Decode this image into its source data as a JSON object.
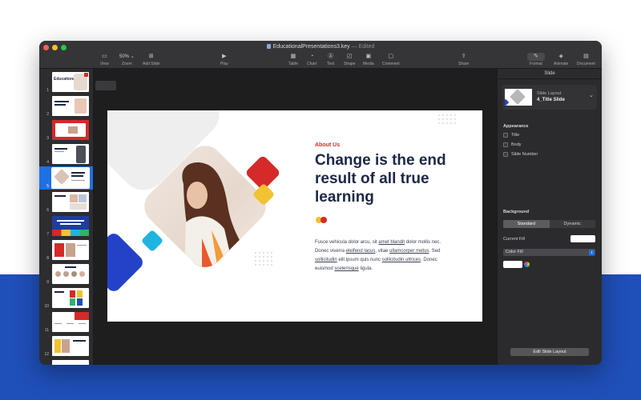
{
  "window": {
    "title": "EducationalPresentations3.key",
    "status": "— Edited"
  },
  "toolbar": {
    "view": "View",
    "zoom_value": "50% ⌄",
    "zoom": "Zoom",
    "add_slide": "Add Slide",
    "play": "Play",
    "table": "Table",
    "chart": "Chart",
    "text": "Text",
    "shape": "Shape",
    "media": "Media",
    "comment": "Comment",
    "share": "Share",
    "format": "Format",
    "animate": "Animate",
    "document": "Document"
  },
  "navigator": {
    "selected": 5,
    "thumbs": [
      {
        "num": "1",
        "title": "Educational"
      },
      {
        "num": "2",
        "title": ""
      },
      {
        "num": "3",
        "title": ""
      },
      {
        "num": "4",
        "title": ""
      },
      {
        "num": "5",
        "title": ""
      },
      {
        "num": "6",
        "title": ""
      },
      {
        "num": "7",
        "title": ""
      },
      {
        "num": "8",
        "title": ""
      },
      {
        "num": "9",
        "title": ""
      },
      {
        "num": "10",
        "title": ""
      },
      {
        "num": "11",
        "title": ""
      },
      {
        "num": "12",
        "title": ""
      }
    ]
  },
  "slide": {
    "eyebrow": "About Us",
    "headline": "Change is the end result of all true learning",
    "body": {
      "p1": "Fusce vehicula dolor arcu, sit ",
      "u1": "amet blandit",
      "p2": " dolor mollis nec. Donec viverra ",
      "u2": "eleifend lacus",
      "p3": ", vitae ",
      "u3": "ullamcorper metus",
      "p4": ". Sed ",
      "u4": "sollicitudin",
      "p5": " elit ipsum quis nunc ",
      "u5": "sollicitudin ultrices",
      "p6": ". Donec euismod ",
      "u6": "scelerisque",
      "p7": " ligula."
    }
  },
  "inspector": {
    "tab": "Slide",
    "layout_label": "Slide Layout",
    "layout_value": "4_Title Slide",
    "appearance": "Appearance",
    "opt_title": "Title",
    "opt_body": "Body",
    "opt_slide_number": "Slide Number",
    "background": "Background",
    "seg_standard": "Standard",
    "seg_dynamic": "Dynamic",
    "current_fill": "Current Fill",
    "fill_type": "Color Fill",
    "edit_layout": "Edit Slide Layout"
  },
  "colors": {
    "accent_blue": "#1f4fb8",
    "headline": "#1c2747",
    "red": "#d42a2a",
    "yellow": "#f2c230",
    "cyan": "#20b4e0",
    "selection": "#1f6fe6"
  }
}
